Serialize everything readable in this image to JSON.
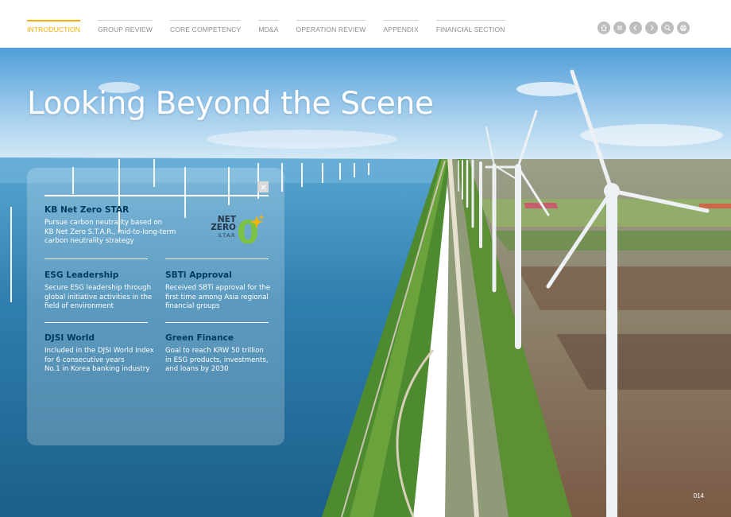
{
  "nav": {
    "items": [
      {
        "label": "INTRODUCTION",
        "active": true
      },
      {
        "label": "GROUP REVIEW",
        "active": false
      },
      {
        "label": "CORE COMPETENCY",
        "active": false
      },
      {
        "label": "MD&A",
        "active": false
      },
      {
        "label": "OPERATION REVIEW",
        "active": false
      },
      {
        "label": "APPENDIX",
        "active": false
      },
      {
        "label": "FINANCIAL SECTION",
        "active": false
      }
    ],
    "tools": [
      "home-icon",
      "menu-icon",
      "prev-icon",
      "next-icon",
      "search-icon",
      "print-icon"
    ]
  },
  "hero": {
    "headline": "Looking Beyond the Scene",
    "page_number": "014"
  },
  "panel": {
    "sections": [
      {
        "title": "KB Net Zero STAR",
        "desc": "Pursue carbon neutrality based on\nKB Net Zero S.T.A.R., mid-to-long-term\ncarbon neutrality strategy"
      },
      {
        "title": "ESG Leadership",
        "desc": "Secure ESG leadership through\nglobal initiative activities in the\nfield of environment"
      },
      {
        "title": "SBTi Approval",
        "desc": "Received SBTi approval for the\nfirst time among Asia regional\nfinancial groups"
      },
      {
        "title": "DJSI World",
        "desc": "Included in the DJSI World Index\nfor 6 consecutive years\nNo.1 in Korea banking industry"
      },
      {
        "title": "Green Finance",
        "desc": "Goal to reach KRW 50 trillion\nin ESG products, investments,\nand loans by 2030"
      }
    ],
    "logo": {
      "line1": "NET",
      "line2": "ZERO",
      "sub": "S.T.A.R.",
      "digit": "0"
    }
  },
  "colors": {
    "accent": "#f3ad00",
    "title_blue": "#003b5c",
    "nav_gray": "#8c8c8c",
    "tool_gray": "#bdbdbd",
    "logo_green": "#7cc243"
  }
}
